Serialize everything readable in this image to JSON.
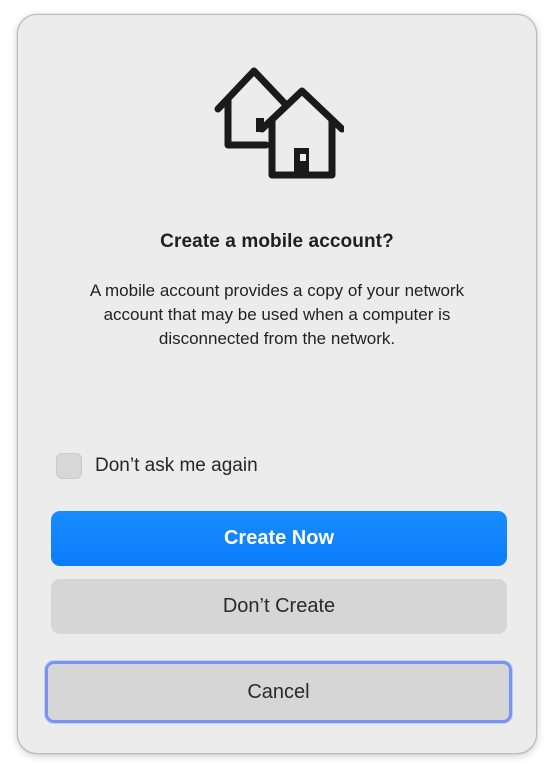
{
  "dialog": {
    "icon": "mobile-account-houses-icon",
    "title": "Create a mobile account?",
    "message": "A mobile account provides a copy of your network account that may be used when a computer is disconnected from the network.",
    "checkbox": {
      "label": "Don’t ask me again",
      "checked": false
    },
    "buttons": {
      "primary": "Create Now",
      "secondary": "Don’t Create",
      "cancel": "Cancel"
    }
  },
  "colors": {
    "dialog_background": "#ececec",
    "primary_button": "#0a7dfc",
    "secondary_button": "#d6d6d6",
    "focus_ring": "#7b93f0"
  }
}
